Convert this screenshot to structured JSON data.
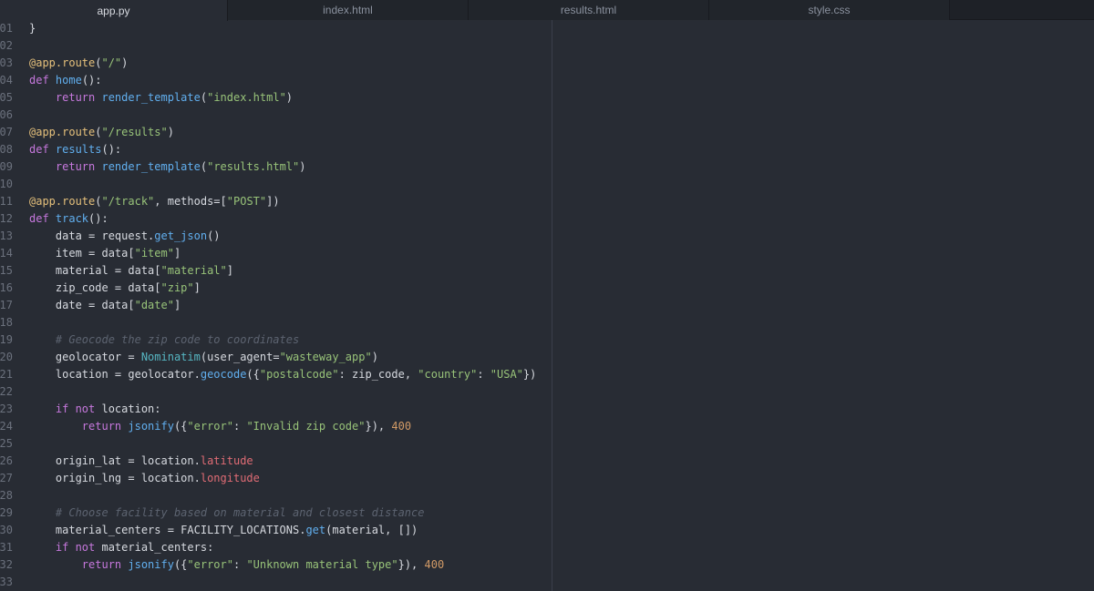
{
  "tabs": [
    {
      "label": "app.py",
      "active": true
    },
    {
      "label": "index.html",
      "active": false
    },
    {
      "label": "results.html",
      "active": false
    },
    {
      "label": "style.css",
      "active": false
    }
  ],
  "editor": {
    "file": "app.py",
    "lines": [
      {
        "n": "01",
        "tokens": [
          [
            "pl",
            "}"
          ]
        ]
      },
      {
        "n": "02",
        "tokens": []
      },
      {
        "n": "03",
        "tokens": [
          [
            "dec",
            "@app.route"
          ],
          [
            "pl",
            "("
          ],
          [
            "str",
            "\"/\""
          ],
          [
            "pl",
            ")"
          ]
        ]
      },
      {
        "n": "04",
        "tokens": [
          [
            "kw",
            "def "
          ],
          [
            "fn",
            "home"
          ],
          [
            "pl",
            "():"
          ]
        ]
      },
      {
        "n": "05",
        "tokens": [
          [
            "pl",
            "    "
          ],
          [
            "kw",
            "return "
          ],
          [
            "fn",
            "render_template"
          ],
          [
            "pl",
            "("
          ],
          [
            "str",
            "\"index.html\""
          ],
          [
            "pl",
            ")"
          ]
        ]
      },
      {
        "n": "06",
        "tokens": []
      },
      {
        "n": "07",
        "tokens": [
          [
            "dec",
            "@app.route"
          ],
          [
            "pl",
            "("
          ],
          [
            "str",
            "\"/results\""
          ],
          [
            "pl",
            ")"
          ]
        ]
      },
      {
        "n": "08",
        "tokens": [
          [
            "kw",
            "def "
          ],
          [
            "fn",
            "results"
          ],
          [
            "pl",
            "():"
          ]
        ]
      },
      {
        "n": "09",
        "tokens": [
          [
            "pl",
            "    "
          ],
          [
            "kw",
            "return "
          ],
          [
            "fn",
            "render_template"
          ],
          [
            "pl",
            "("
          ],
          [
            "str",
            "\"results.html\""
          ],
          [
            "pl",
            ")"
          ]
        ]
      },
      {
        "n": "10",
        "tokens": []
      },
      {
        "n": "11",
        "tokens": [
          [
            "dec",
            "@app.route"
          ],
          [
            "pl",
            "("
          ],
          [
            "str",
            "\"/track\""
          ],
          [
            "pl",
            ", methods=["
          ],
          [
            "str",
            "\"POST\""
          ],
          [
            "pl",
            "])"
          ]
        ]
      },
      {
        "n": "12",
        "tokens": [
          [
            "kw",
            "def "
          ],
          [
            "fn",
            "track"
          ],
          [
            "pl",
            "():"
          ]
        ]
      },
      {
        "n": "13",
        "tokens": [
          [
            "pl",
            "    data = request."
          ],
          [
            "fn",
            "get_json"
          ],
          [
            "pl",
            "()"
          ]
        ]
      },
      {
        "n": "14",
        "tokens": [
          [
            "pl",
            "    item = data["
          ],
          [
            "str",
            "\"item\""
          ],
          [
            "pl",
            "]"
          ]
        ]
      },
      {
        "n": "15",
        "tokens": [
          [
            "pl",
            "    material = data["
          ],
          [
            "str",
            "\"material\""
          ],
          [
            "pl",
            "]"
          ]
        ]
      },
      {
        "n": "16",
        "tokens": [
          [
            "pl",
            "    zip_code = data["
          ],
          [
            "str",
            "\"zip\""
          ],
          [
            "pl",
            "]"
          ]
        ]
      },
      {
        "n": "17",
        "tokens": [
          [
            "pl",
            "    date = data["
          ],
          [
            "str",
            "\"date\""
          ],
          [
            "pl",
            "]"
          ]
        ]
      },
      {
        "n": "18",
        "tokens": []
      },
      {
        "n": "19",
        "tokens": [
          [
            "cm",
            "    # Geocode the zip code to coordinates"
          ]
        ]
      },
      {
        "n": "20",
        "tokens": [
          [
            "pl",
            "    geolocator = "
          ],
          [
            "cls",
            "Nominatim"
          ],
          [
            "pl",
            "(user_agent="
          ],
          [
            "str",
            "\"wasteway_app\""
          ],
          [
            "pl",
            ")"
          ]
        ]
      },
      {
        "n": "21",
        "tokens": [
          [
            "pl",
            "    location = geolocator."
          ],
          [
            "fn",
            "geocode"
          ],
          [
            "pl",
            "({"
          ],
          [
            "str",
            "\"postalcode\""
          ],
          [
            "pl",
            ": zip_code, "
          ],
          [
            "str",
            "\"country\""
          ],
          [
            "pl",
            ": "
          ],
          [
            "str",
            "\"USA\""
          ],
          [
            "pl",
            "})"
          ]
        ]
      },
      {
        "n": "22",
        "tokens": []
      },
      {
        "n": "23",
        "tokens": [
          [
            "pl",
            "    "
          ],
          [
            "kw",
            "if not "
          ],
          [
            "pl",
            "location:"
          ]
        ]
      },
      {
        "n": "24",
        "tokens": [
          [
            "pl",
            "        "
          ],
          [
            "kw",
            "return "
          ],
          [
            "fn",
            "jsonify"
          ],
          [
            "pl",
            "({"
          ],
          [
            "str",
            "\"error\""
          ],
          [
            "pl",
            ": "
          ],
          [
            "str",
            "\"Invalid zip code\""
          ],
          [
            "pl",
            "}), "
          ],
          [
            "num",
            "400"
          ]
        ]
      },
      {
        "n": "25",
        "tokens": []
      },
      {
        "n": "26",
        "tokens": [
          [
            "pl",
            "    origin_lat = location."
          ],
          [
            "attr",
            "latitude"
          ]
        ]
      },
      {
        "n": "27",
        "tokens": [
          [
            "pl",
            "    origin_lng = location."
          ],
          [
            "attr",
            "longitude"
          ]
        ]
      },
      {
        "n": "28",
        "tokens": []
      },
      {
        "n": "29",
        "tokens": [
          [
            "cm",
            "    # Choose facility based on material and closest distance"
          ]
        ]
      },
      {
        "n": "30",
        "tokens": [
          [
            "pl",
            "    material_centers = FACILITY_LOCATIONS."
          ],
          [
            "fn",
            "get"
          ],
          [
            "pl",
            "(material, [])"
          ]
        ]
      },
      {
        "n": "31",
        "tokens": [
          [
            "pl",
            "    "
          ],
          [
            "kw",
            "if not "
          ],
          [
            "pl",
            "material_centers:"
          ]
        ]
      },
      {
        "n": "32",
        "tokens": [
          [
            "pl",
            "        "
          ],
          [
            "kw",
            "return "
          ],
          [
            "fn",
            "jsonify"
          ],
          [
            "pl",
            "({"
          ],
          [
            "str",
            "\"error\""
          ],
          [
            "pl",
            ": "
          ],
          [
            "str",
            "\"Unknown material type\""
          ],
          [
            "pl",
            "}), "
          ],
          [
            "num",
            "400"
          ]
        ]
      },
      {
        "n": "33",
        "tokens": []
      }
    ]
  },
  "colors": {
    "background": "#282c34",
    "tabbar": "#21252b",
    "keyword": "#c678dd",
    "function": "#61afef",
    "string": "#98c379",
    "decorator": "#e5c07b",
    "number": "#d19a66",
    "attribute": "#e06c75",
    "comment": "#5c6370"
  }
}
